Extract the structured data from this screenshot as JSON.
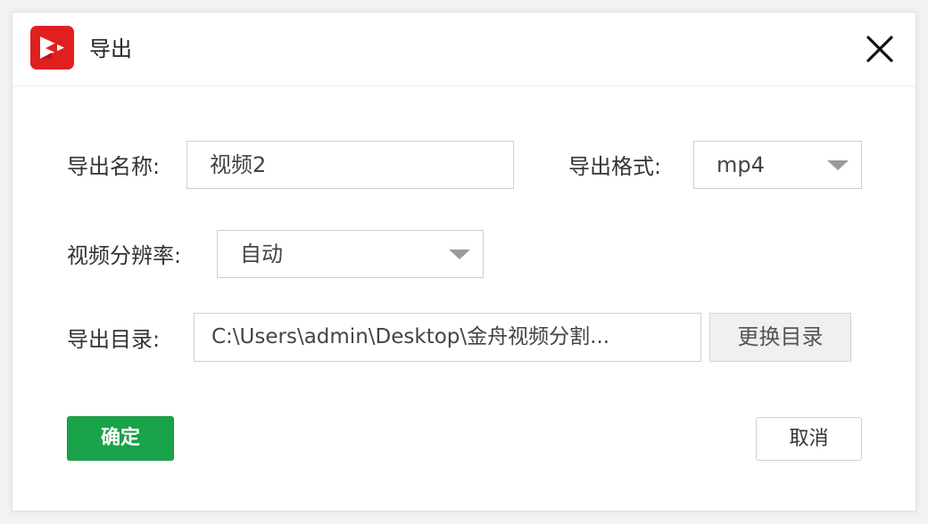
{
  "window": {
    "title": "导出",
    "logo_icon": "video-play-logo-icon",
    "close_icon": "close-icon",
    "logo_color": "#e02020"
  },
  "form": {
    "name_label": "导出名称:",
    "name_value": "视频2",
    "format_label": "导出格式:",
    "format_value": "mp4",
    "resolution_label": "视频分辨率:",
    "resolution_value": "自动",
    "directory_label": "导出目录:",
    "directory_value": "C:\\Users\\admin\\Desktop\\金舟视频分割...",
    "change_directory_label": "更换目录"
  },
  "actions": {
    "ok_label": "确定",
    "cancel_label": "取消",
    "ok_color": "#1aa34a"
  }
}
